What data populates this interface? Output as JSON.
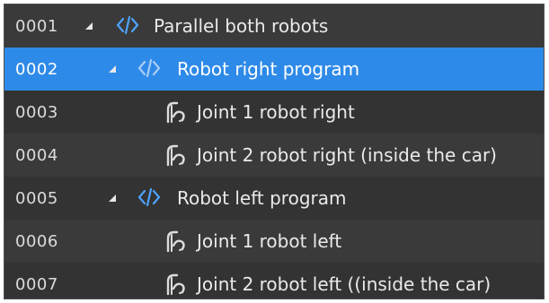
{
  "tree": {
    "rows": [
      {
        "num": "0001",
        "label": "Parallel both robots",
        "type": "program",
        "level": 0,
        "expanded": true,
        "selected": false
      },
      {
        "num": "0002",
        "label": "Robot right program",
        "type": "program",
        "level": 1,
        "expanded": true,
        "selected": true
      },
      {
        "num": "0003",
        "label": "Joint 1 robot right",
        "type": "joint",
        "level": 2,
        "selected": false
      },
      {
        "num": "0004",
        "label": "Joint 2 robot right (inside the car)",
        "type": "joint",
        "level": 2,
        "selected": false
      },
      {
        "num": "0005",
        "label": "Robot left program",
        "type": "program",
        "level": 1,
        "expanded": true,
        "selected": false
      },
      {
        "num": "0006",
        "label": "Joint 1 robot left",
        "type": "joint",
        "level": 2,
        "selected": false
      },
      {
        "num": "0007",
        "label": "Joint 2 robot left ((inside the car)",
        "type": "joint",
        "level": 2,
        "selected": false
      }
    ]
  },
  "colors": {
    "background": "#3a3a3a",
    "selected": "#2e8ae8",
    "code_icon": "#4da3ff",
    "code_icon_selected": "#a9cdf5",
    "joint_icon": "#dcdcdc"
  },
  "icons": {
    "expand": "caret-expanded-icon",
    "program": "code-brackets-icon",
    "joint": "joint-move-icon"
  }
}
